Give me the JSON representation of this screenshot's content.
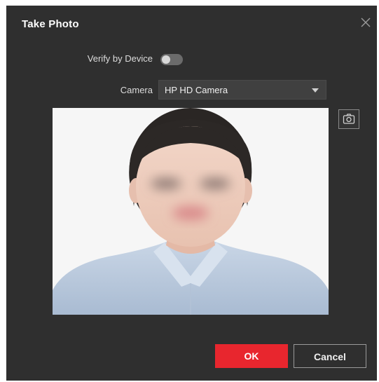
{
  "dialog": {
    "title": "Take Photo",
    "close_icon": "close-icon"
  },
  "verify": {
    "label": "Verify by Device",
    "enabled": false
  },
  "camera": {
    "label": "Camera",
    "selected": "HP HD Camera"
  },
  "preview": {
    "content": "portrait-photo",
    "capture_icon": "camera-icon"
  },
  "buttons": {
    "ok_label": "OK",
    "cancel_label": "Cancel"
  },
  "colors": {
    "dialog_bg": "#2f2f2f",
    "ok_bg": "#e8262e",
    "toggle_off": "#6b6b6b",
    "select_bg": "#404040"
  }
}
